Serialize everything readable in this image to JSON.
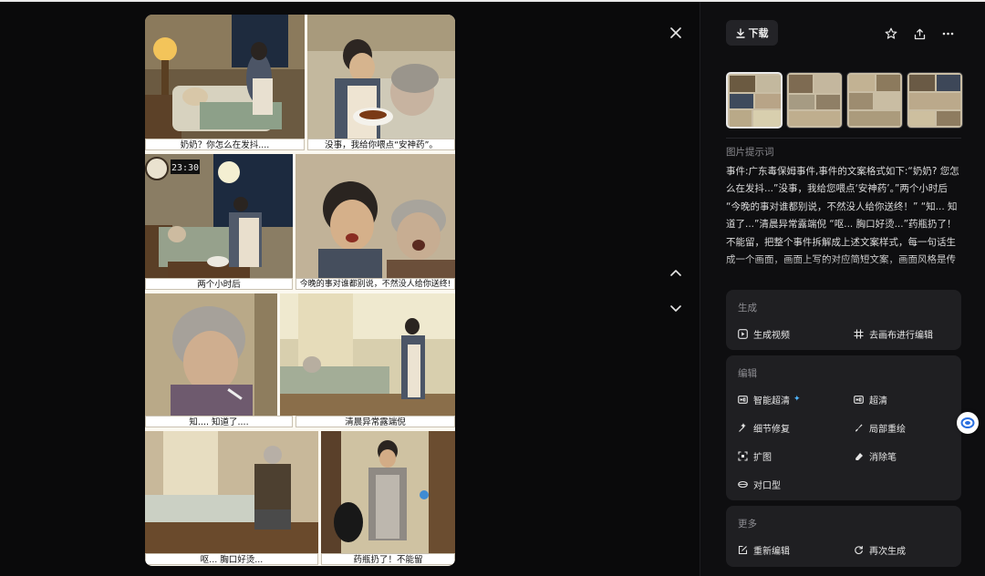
{
  "viewer": {
    "close_icon": "close-icon",
    "prev_icon": "chevron-up-icon",
    "next_icon": "chevron-down-icon",
    "captions": [
      "奶奶？你怎么在发抖....",
      "没事，我给你喂点“安神药”。",
      "两个小时后",
      "今晚的事对谁都别说，不然没人给你送终!",
      "知.... 知道了....",
      "清晨异常露端倪",
      "呕... 胸口好烫...",
      "药瓶扔了！不能留"
    ],
    "clock_text": "23:30"
  },
  "toolbar": {
    "download_label": "下载",
    "download_icon": "download-icon",
    "star_icon": "star-icon",
    "share_icon": "share-icon",
    "more_icon": "more-icon"
  },
  "thumbnails": {
    "count": 4,
    "selected_index": 0
  },
  "prompt": {
    "title": "图片提示词",
    "text": "事件:广东毒保姆事件,事件的文案格式如下:“奶奶? 您怎么在发抖...”没事，我给您喂点‘安神药’。”两个小时后 “今晚的事对谁都别说，不然没人给你送终！” “知... 知道了...”清晨异常露端倪 “呕... 胸口好烫...”药瓶扔了！不能留，把整个事件拆解成上述文案样式，每一句话生成一个画面，画面上写的对应简短文案，画面风格是传统工笔与数字绘画风格,要求能清晰展现整个过程"
  },
  "generate": {
    "title": "生成",
    "video_label": "生成视频",
    "canvas_label": "去画布进行编辑"
  },
  "edit": {
    "title": "编辑",
    "smart_hd_label": "智能超清",
    "hd_label": "超清",
    "detail_label": "细节修复",
    "inpaint_label": "局部重绘",
    "expand_label": "扩图",
    "eraser_label": "消除笔",
    "lipsync_label": "对口型"
  },
  "more": {
    "title": "更多",
    "reedit_label": "重新编辑",
    "regenerate_label": "再次生成"
  },
  "colors": {
    "accent": "#4fb6ff",
    "panel_bg": "#1f1f22",
    "sidebar_bg": "#0e0e10",
    "comic_paper": "#fbf8f0"
  }
}
